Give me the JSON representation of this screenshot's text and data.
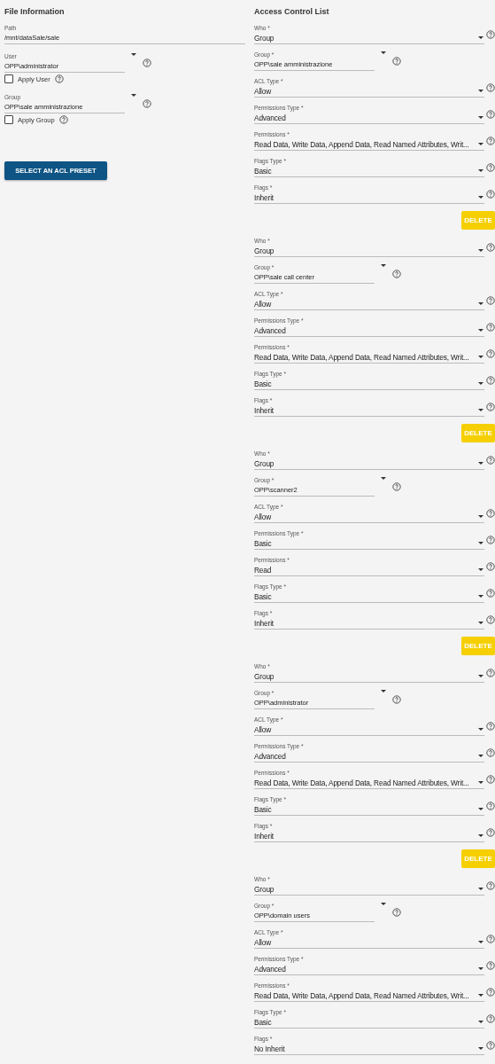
{
  "file_information": {
    "title": "File Information",
    "fields": [
      {
        "kind": "text",
        "label": "Path",
        "value": "/mnt/dataSale/sale"
      },
      {
        "kind": "combo",
        "label": "User",
        "value": "OPP\\administrator",
        "checkbox": {
          "label": "Apply User",
          "checked": false
        }
      },
      {
        "kind": "combo",
        "label": "Group",
        "value": "OPP\\sale amministrazione",
        "checkbox": {
          "label": "Apply Group",
          "checked": false
        }
      }
    ],
    "preset_button": "SELECT AN ACL PRESET"
  },
  "access_control_list": {
    "title": "Access Control List",
    "entries": [
      {
        "fields": [
          {
            "kind": "select",
            "label": "Who *",
            "value": "Group"
          },
          {
            "kind": "combo",
            "label": "Group *",
            "value": "OPP\\sale amministrazione"
          },
          {
            "kind": "select",
            "label": "ACL Type *",
            "value": "Allow"
          },
          {
            "kind": "select",
            "label": "Permissions Type *",
            "value": "Advanced"
          },
          {
            "kind": "select",
            "label": "Permissions *",
            "value": "Read Data, Write Data, Append Data, Read Named Attributes, Writ..."
          },
          {
            "kind": "select",
            "label": "Flags Type *",
            "value": "Basic"
          },
          {
            "kind": "select",
            "label": "Flags *",
            "value": "Inherit"
          }
        ],
        "delete_button": "DELETE"
      },
      {
        "fields": [
          {
            "kind": "select",
            "label": "Who *",
            "value": "Group"
          },
          {
            "kind": "combo",
            "label": "Group *",
            "value": "OPP\\sale call center"
          },
          {
            "kind": "select",
            "label": "ACL Type *",
            "value": "Allow"
          },
          {
            "kind": "select",
            "label": "Permissions Type *",
            "value": "Advanced"
          },
          {
            "kind": "select",
            "label": "Permissions *",
            "value": "Read Data, Write Data, Append Data, Read Named Attributes, Writ..."
          },
          {
            "kind": "select",
            "label": "Flags Type *",
            "value": "Basic"
          },
          {
            "kind": "select",
            "label": "Flags *",
            "value": "Inherit"
          }
        ],
        "delete_button": "DELETE"
      },
      {
        "fields": [
          {
            "kind": "select",
            "label": "Who *",
            "value": "Group"
          },
          {
            "kind": "combo",
            "label": "Group *",
            "value": "OPP\\scanner2"
          },
          {
            "kind": "select",
            "label": "ACL Type *",
            "value": "Allow"
          },
          {
            "kind": "select",
            "label": "Permissions Type *",
            "value": "Basic"
          },
          {
            "kind": "select",
            "label": "Permissions *",
            "value": "Read"
          },
          {
            "kind": "select",
            "label": "Flags Type *",
            "value": "Basic"
          },
          {
            "kind": "select",
            "label": "Flags *",
            "value": "Inherit"
          }
        ],
        "delete_button": "DELETE"
      },
      {
        "fields": [
          {
            "kind": "select",
            "label": "Who *",
            "value": "Group"
          },
          {
            "kind": "combo",
            "label": "Group *",
            "value": "OPP\\administrator"
          },
          {
            "kind": "select",
            "label": "ACL Type *",
            "value": "Allow"
          },
          {
            "kind": "select",
            "label": "Permissions Type *",
            "value": "Advanced"
          },
          {
            "kind": "select",
            "label": "Permissions *",
            "value": "Read Data, Write Data, Append Data, Read Named Attributes, Writ..."
          },
          {
            "kind": "select",
            "label": "Flags Type *",
            "value": "Basic"
          },
          {
            "kind": "select",
            "label": "Flags *",
            "value": "Inherit"
          }
        ],
        "delete_button": "DELETE"
      },
      {
        "fields": [
          {
            "kind": "select",
            "label": "Who *",
            "value": "Group"
          },
          {
            "kind": "combo",
            "label": "Group *",
            "value": "OPP\\domain users"
          },
          {
            "kind": "select",
            "label": "ACL Type *",
            "value": "Allow"
          },
          {
            "kind": "select",
            "label": "Permissions Type *",
            "value": "Advanced"
          },
          {
            "kind": "select",
            "label": "Permissions *",
            "value": "Read Data, Write Data, Append Data, Read Named Attributes, Writ..."
          },
          {
            "kind": "select",
            "label": "Flags Type *",
            "value": "Basic"
          },
          {
            "kind": "select",
            "label": "Flags *",
            "value": "No Inherit"
          }
        ]
      }
    ]
  }
}
